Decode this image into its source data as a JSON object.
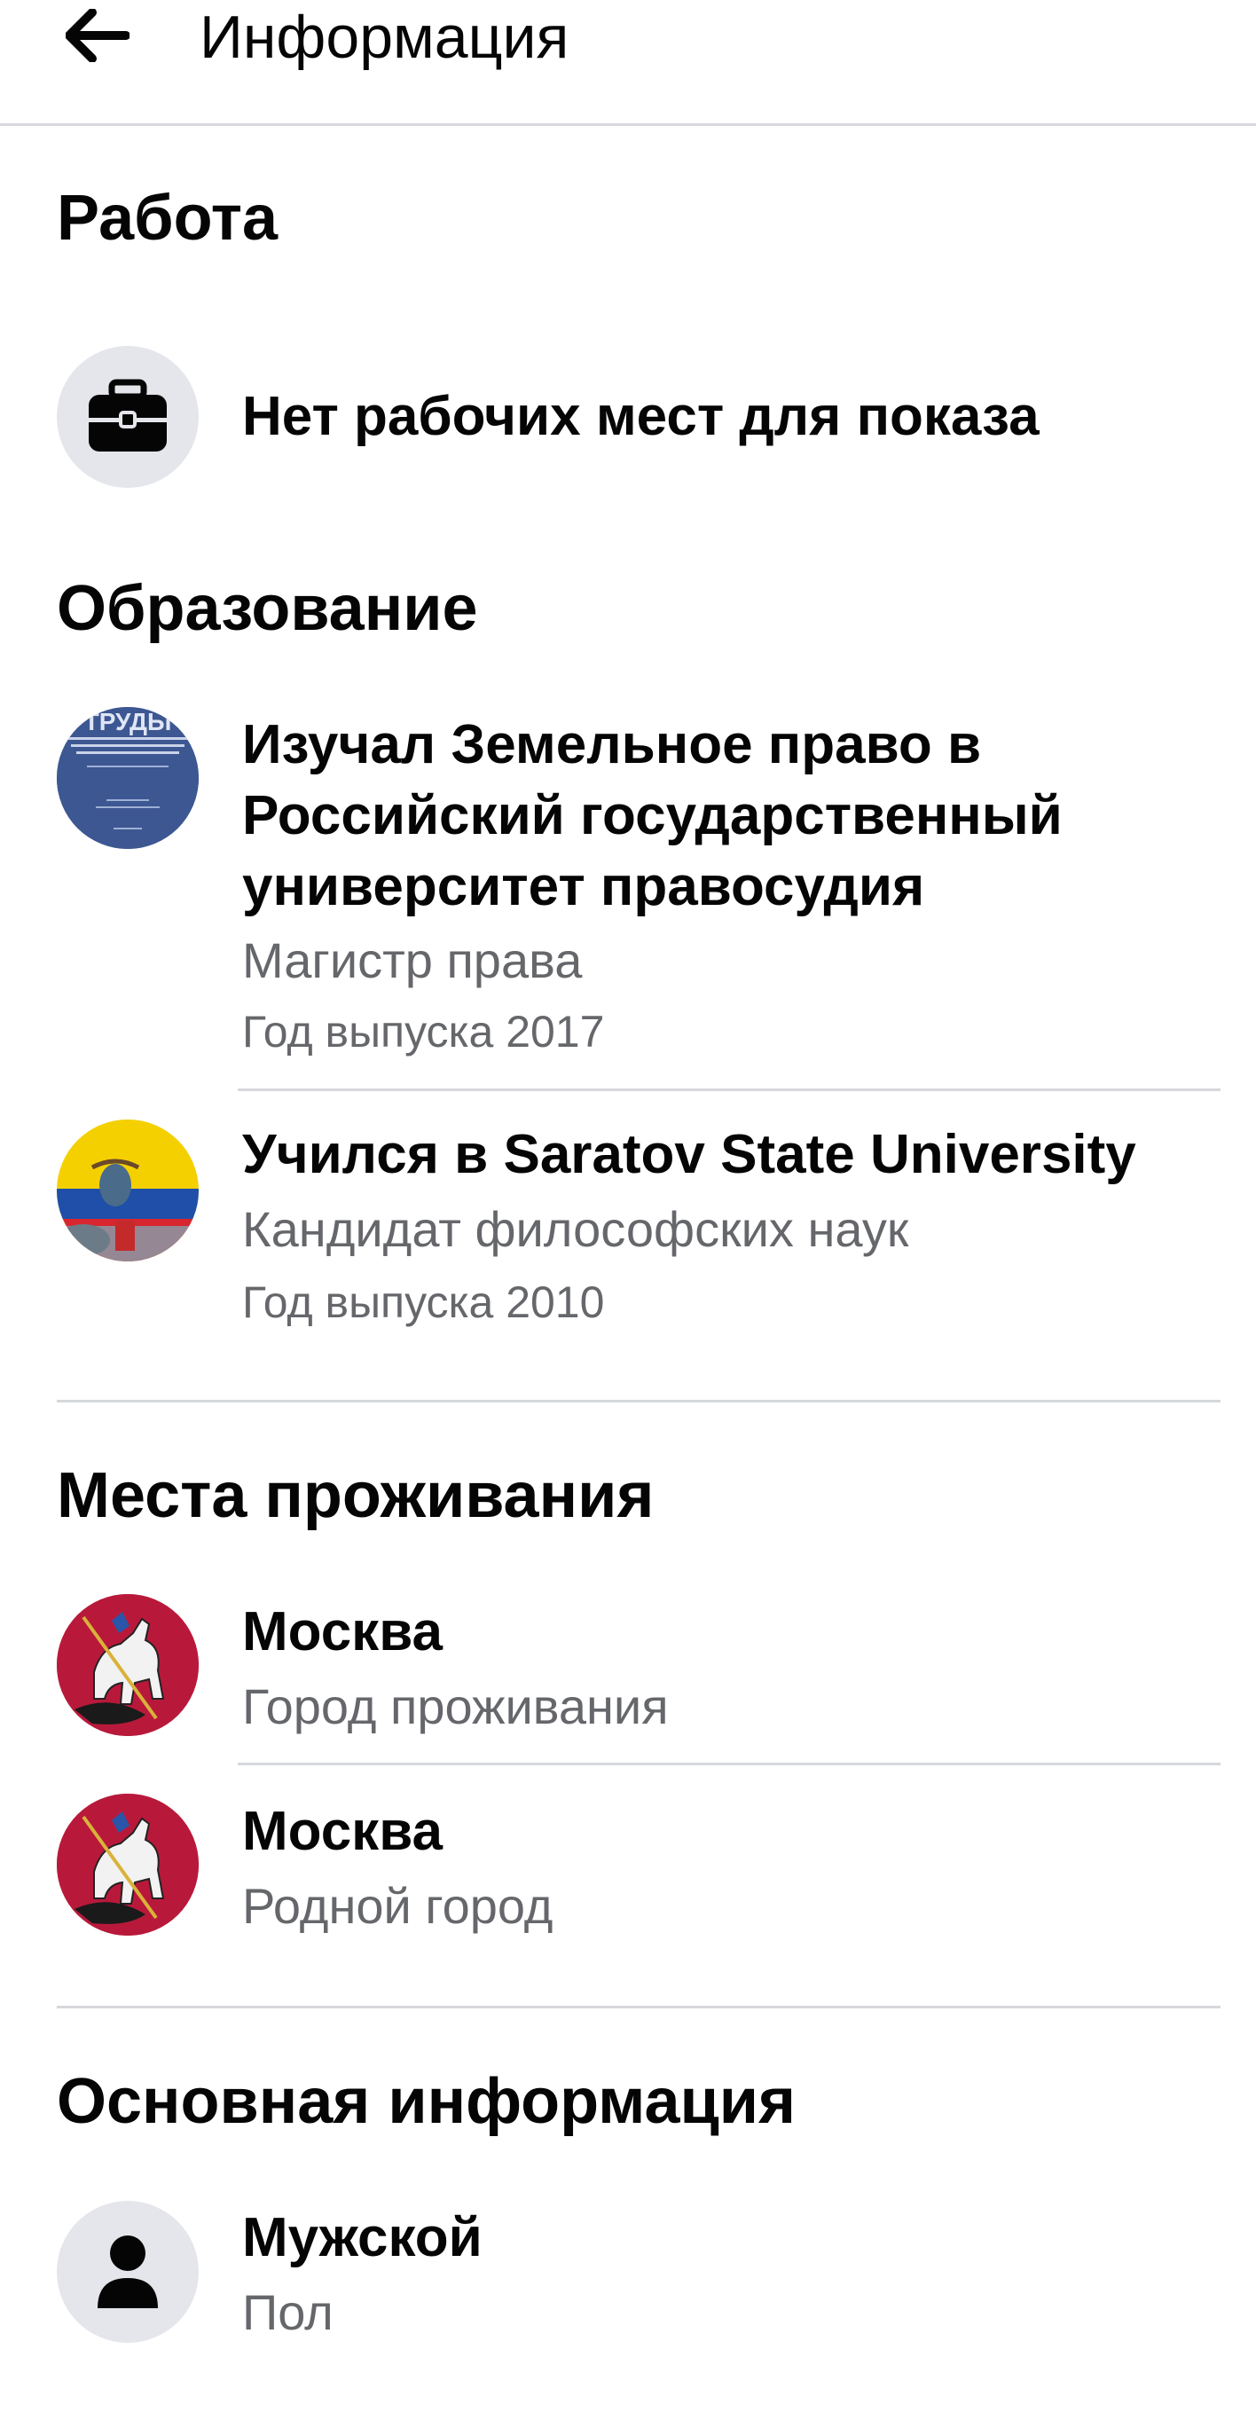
{
  "header": {
    "title": "Информация"
  },
  "work": {
    "title": "Работа",
    "empty_text": "Нет рабочих мест для показа"
  },
  "education": {
    "title": "Образование",
    "items": [
      {
        "line1": "Изучал Земельное право в",
        "line2": "Российский государственный",
        "line3": "университет правосудия",
        "degree": "Магистр права",
        "year": "Год выпуска 2017",
        "logo_text": "ТРУДЫ"
      },
      {
        "line1": "Учился в Saratov State University",
        "degree": "Кандидат философских наук",
        "year": "Год выпуска 2010"
      }
    ]
  },
  "places": {
    "title": "Места проживания",
    "items": [
      {
        "city": "Москва",
        "label": "Город проживания"
      },
      {
        "city": "Москва",
        "label": "Родной город"
      }
    ]
  },
  "basic": {
    "title": "Основная информация",
    "items": [
      {
        "value": "Мужской",
        "label": "Пол"
      }
    ]
  },
  "colors": {
    "icon_bg": "#e4e6eb",
    "divider": "#d6d8dc",
    "secondary_text": "#65676b",
    "flag_yellow": "#f5d000",
    "flag_blue": "#1f4fa8",
    "flag_red": "#d8262f",
    "moscow_red": "#b8193a"
  }
}
